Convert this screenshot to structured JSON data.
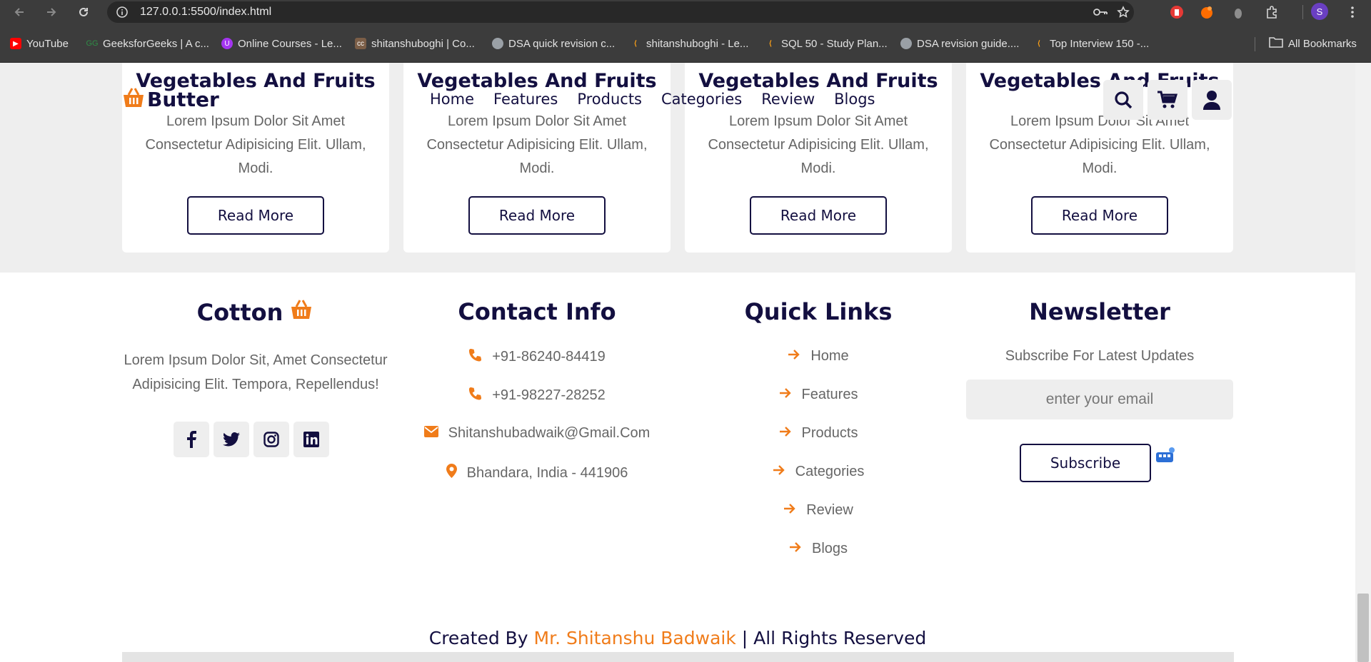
{
  "browser": {
    "url": "127.0.0.1:5500/index.html",
    "profile_initial": "S",
    "bookmarks": [
      {
        "label": "YouTube",
        "icon": "youtube-icon",
        "color": "#ff0000"
      },
      {
        "label": "GeeksforGeeks | A c...",
        "icon": "geeksforgeeks-icon",
        "color": "#2f8d46"
      },
      {
        "label": "Online Courses - Le...",
        "icon": "udemy-icon",
        "color": "#a435f0"
      },
      {
        "label": "shitanshuboghi | Co...",
        "icon": "codechef-icon",
        "color": "#7b5e47"
      },
      {
        "label": "DSA quick revision c...",
        "icon": "globe-icon",
        "color": "#9aa0a6"
      },
      {
        "label": "shitanshuboghi - Le...",
        "icon": "leetcode-icon",
        "color": "#ffa116"
      },
      {
        "label": "SQL 50 - Study Plan...",
        "icon": "leetcode-icon",
        "color": "#ffa116"
      },
      {
        "label": "DSA revision guide....",
        "icon": "globe-icon",
        "color": "#9aa0a6"
      },
      {
        "label": "Top Interview 150 -...",
        "icon": "leetcode-icon",
        "color": "#ffa116"
      }
    ],
    "all_bookmarks": "All Bookmarks"
  },
  "header": {
    "logo_text": "Butter",
    "nav": [
      "Home",
      "Features",
      "Products",
      "Categories",
      "Review",
      "Blogs"
    ]
  },
  "cards": [
    {
      "title": "Vegetables And Fruits",
      "text": "Lorem Ipsum Dolor Sit Amet Consectetur Adipisicing Elit. Ullam, Modi.",
      "button": "Read More"
    },
    {
      "title": "Vegetables And Fruits",
      "text": "Lorem Ipsum Dolor Sit Amet Consectetur Adipisicing Elit. Ullam, Modi.",
      "button": "Read More"
    },
    {
      "title": "Vegetables And Fruits",
      "text": "Lorem Ipsum Dolor Sit Amet Consectetur Adipisicing Elit. Ullam, Modi.",
      "button": "Read More"
    },
    {
      "title": "Vegetables And Fruits",
      "text": "Lorem Ipsum Dolor Sit Amet Consectetur Adipisicing Elit. Ullam, Modi.",
      "button": "Read More"
    }
  ],
  "footer": {
    "brand": {
      "title": "Cotton",
      "description": "Lorem Ipsum Dolor Sit, Amet Consectetur Adipisicing Elit. Tempora, Repellendus!",
      "socials": [
        "facebook-icon",
        "twitter-icon",
        "instagram-icon",
        "linkedin-icon"
      ]
    },
    "contact": {
      "title": "Contact Info",
      "phone1": "+91-86240-84419",
      "phone2": "+91-98227-28252",
      "email": "Shitanshubadwaik@Gmail.Com",
      "address": "Bhandara, India - 441906"
    },
    "quick_links": {
      "title": "Quick Links",
      "links": [
        "Home",
        "Features",
        "Products",
        "Categories",
        "Review",
        "Blogs"
      ]
    },
    "newsletter": {
      "title": "Newsletter",
      "subtitle": "Subscribe For Latest Updates",
      "placeholder": "enter your email",
      "button": "Subscribe"
    },
    "credit": {
      "prefix": "Created By",
      "name": "Mr. Shitanshu Badwaik",
      "suffix": "| All Rights Reserved"
    }
  },
  "colors": {
    "accent": "#f07c1a",
    "dark": "#130f40",
    "text": "#666666",
    "light_bg": "#eeeeee"
  }
}
